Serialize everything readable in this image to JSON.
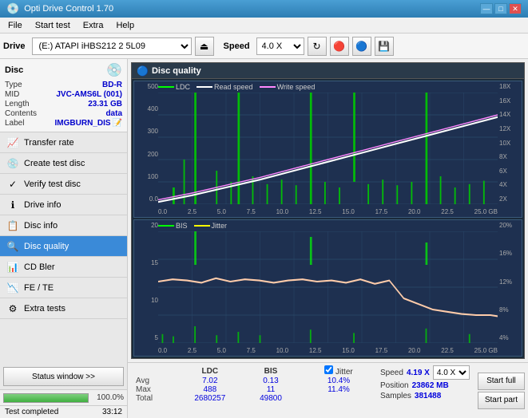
{
  "app": {
    "title": "Opti Drive Control 1.70",
    "title_icon": "💿"
  },
  "title_controls": {
    "minimize": "—",
    "maximize": "□",
    "close": "✕"
  },
  "menu": {
    "items": [
      "File",
      "Start test",
      "Extra",
      "Help"
    ]
  },
  "toolbar": {
    "drive_label": "Drive",
    "drive_value": "(E:)  ATAPI iHBS212  2 5L09",
    "eject_icon": "⏏",
    "speed_label": "Speed",
    "speed_value": "4.0 X",
    "refresh_icon": "↻",
    "icon1": "🔴",
    "icon2": "🔵",
    "icon3": "💾"
  },
  "disc": {
    "panel_label": "Disc",
    "icon": "💿",
    "type_label": "Type",
    "type_value": "BD-R",
    "mid_label": "MID",
    "mid_value": "JVC-AMS6L (001)",
    "length_label": "Length",
    "length_value": "23.31 GB",
    "contents_label": "Contents",
    "contents_value": "data",
    "label_label": "Label",
    "label_value": "IMGBURN_DIS",
    "label_icon": "📝"
  },
  "nav": {
    "items": [
      {
        "id": "transfer-rate",
        "label": "Transfer rate",
        "icon": "📈"
      },
      {
        "id": "create-test-disc",
        "label": "Create test disc",
        "icon": "💿"
      },
      {
        "id": "verify-test-disc",
        "label": "Verify test disc",
        "icon": "✓"
      },
      {
        "id": "drive-info",
        "label": "Drive info",
        "icon": "ℹ"
      },
      {
        "id": "disc-info",
        "label": "Disc info",
        "icon": "📋"
      },
      {
        "id": "disc-quality",
        "label": "Disc quality",
        "icon": "🔍",
        "active": true
      },
      {
        "id": "cd-bler",
        "label": "CD Bler",
        "icon": "📊"
      },
      {
        "id": "fe-te",
        "label": "FE / TE",
        "icon": "📉"
      },
      {
        "id": "extra-tests",
        "label": "Extra tests",
        "icon": "⚙"
      }
    ]
  },
  "status_btn": "Status window >>",
  "quality_panel": {
    "title": "Disc quality",
    "icon": "🔵"
  },
  "chart_top": {
    "legend": [
      {
        "label": "LDC",
        "color": "#00ff00"
      },
      {
        "label": "Read speed",
        "color": "#ffffff"
      },
      {
        "label": "Write speed",
        "color": "#ff88ff"
      }
    ],
    "y_labels_left": [
      "500",
      "400",
      "300",
      "200",
      "100",
      "0.0"
    ],
    "y_labels_right": [
      "18X",
      "16X",
      "14X",
      "12X",
      "10X",
      "8X",
      "6X",
      "4X",
      "2X"
    ],
    "x_labels": [
      "0.0",
      "2.5",
      "5.0",
      "7.5",
      "10.0",
      "12.5",
      "15.0",
      "17.5",
      "20.0",
      "22.5",
      "25.0 GB"
    ]
  },
  "chart_bottom": {
    "legend": [
      {
        "label": "BIS",
        "color": "#00ff00"
      },
      {
        "label": "Jitter",
        "color": "#ffff00"
      }
    ],
    "y_labels_left": [
      "20",
      "15",
      "10",
      "5"
    ],
    "y_labels_right": [
      "20%",
      "16%",
      "12%",
      "8%",
      "4%"
    ],
    "x_labels": [
      "0.0",
      "2.5",
      "5.0",
      "7.5",
      "10.0",
      "12.5",
      "15.0",
      "17.5",
      "20.0",
      "22.5",
      "25.0 GB"
    ]
  },
  "stats": {
    "headers": [
      "",
      "LDC",
      "BIS",
      "",
      "Jitter",
      "Speed",
      "",
      ""
    ],
    "avg_label": "Avg",
    "avg_ldc": "7.02",
    "avg_bis": "0.13",
    "avg_jitter": "10.4%",
    "max_label": "Max",
    "max_ldc": "488",
    "max_bis": "11",
    "max_jitter": "11.4%",
    "total_label": "Total",
    "total_ldc": "2680257",
    "total_bis": "49800",
    "speed_label": "Speed",
    "speed_value": "4.19 X",
    "speed_select": "4.0 X",
    "position_label": "Position",
    "position_value": "23862 MB",
    "samples_label": "Samples",
    "samples_value": "381488",
    "jitter_checked": true,
    "btn_start_full": "Start full",
    "btn_start_part": "Start part"
  },
  "progress": {
    "percent": 100,
    "percent_text": "100.0%",
    "status_text": "Test completed",
    "time_text": "33:12"
  }
}
